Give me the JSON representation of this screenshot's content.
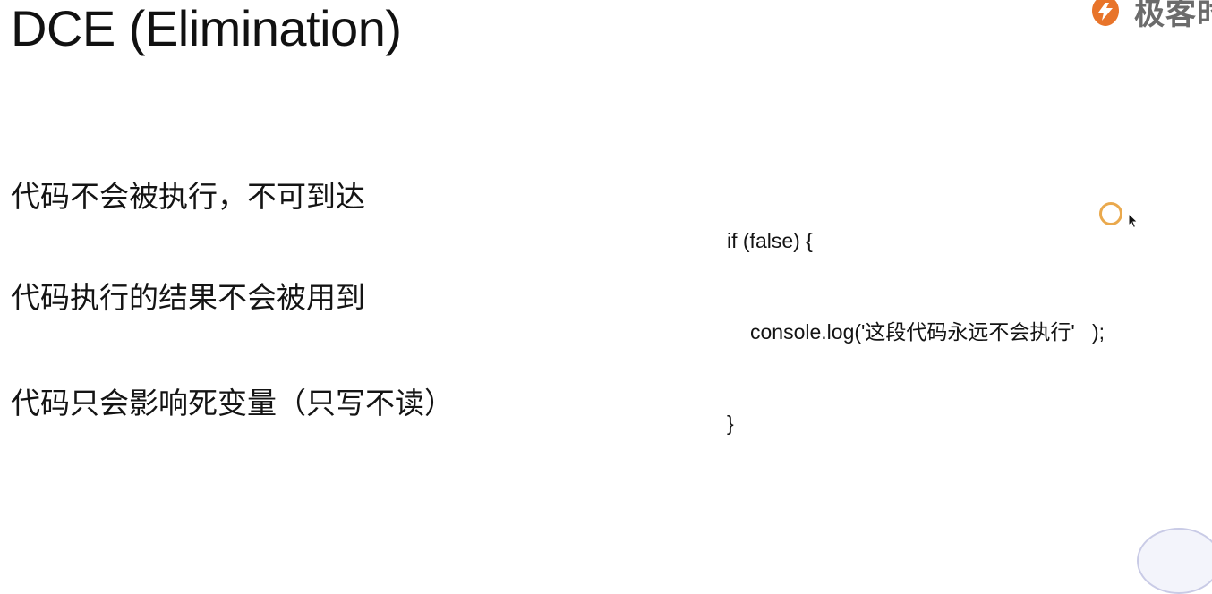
{
  "slide": {
    "title": "DCE (Elimination)",
    "logo": {
      "icon": "geekbang-logo-icon",
      "text": "极客时",
      "brand_color": "#e8742a"
    },
    "points": [
      "代码不会被执行，不可到达",
      "代码执行的结果不会被用到",
      "代码只会影响死变量（只写不读）"
    ],
    "code": {
      "line1": "if (false) {",
      "line2": "console.log('这段代码永远不会执行'   );",
      "line3": "}"
    }
  },
  "pointer": {
    "icon": "mouse-pointer-icon",
    "highlight_color": "#e8a03a"
  }
}
